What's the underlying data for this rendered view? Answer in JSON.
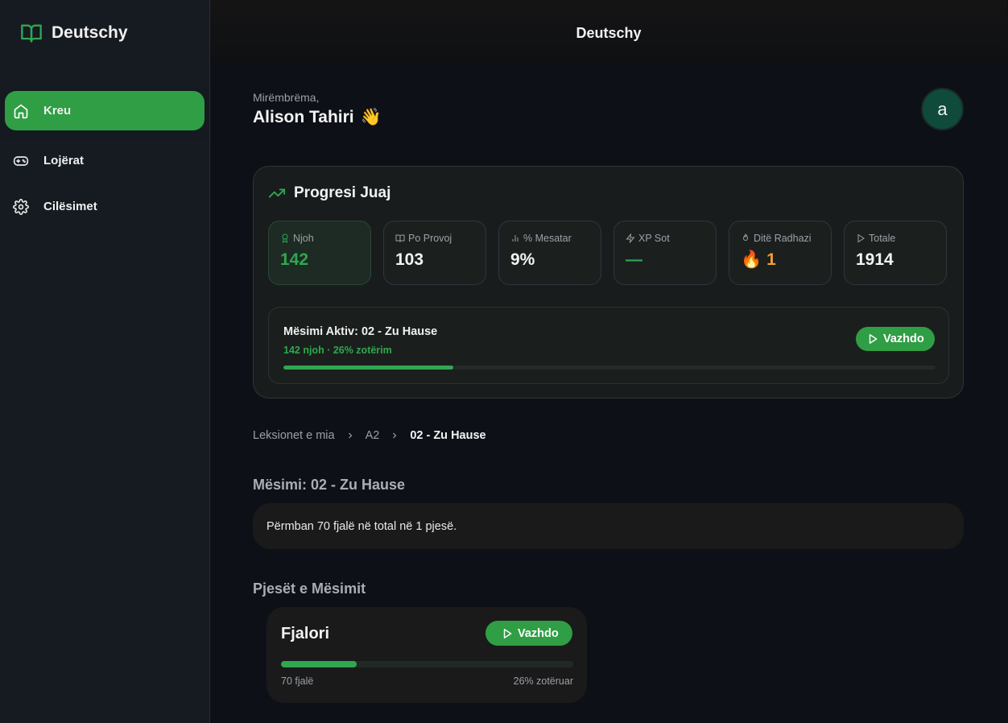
{
  "app": {
    "brand": "Deutschy",
    "topbar_title": "Deutschy"
  },
  "sidebar": {
    "items": [
      {
        "label": "Kreu",
        "icon": "home-icon",
        "active": true
      },
      {
        "label": "Lojërat",
        "icon": "gamepad-icon",
        "active": false
      },
      {
        "label": "Cilësimet",
        "icon": "gear-icon",
        "active": false
      }
    ]
  },
  "greeting": {
    "small": "Mirëmbrëma,",
    "name": "Alison Tahiri",
    "emoji": "👋"
  },
  "avatar": {
    "letter": "a"
  },
  "progress": {
    "title": "Progresi Juaj",
    "stats": [
      {
        "label": "Njoh",
        "icon": "award-icon",
        "value": "142"
      },
      {
        "label": "Po Provoj",
        "icon": "book-icon",
        "value": "103"
      },
      {
        "label": "% Mesatar",
        "icon": "bar-chart-icon",
        "value": "9%"
      },
      {
        "label": "XP Sot",
        "icon": "zap-icon",
        "value": "—"
      },
      {
        "label": "Ditë Radhazi",
        "icon": "flame-icon",
        "value": "1",
        "emoji": "🔥"
      },
      {
        "label": "Totale",
        "icon": "play-icon",
        "value": "1914"
      }
    ],
    "active_lesson": {
      "title": "Mësimi Aktiv: 02 - Zu Hause",
      "subtitle": "142 njoh · 26% zotërim",
      "progress_percent": 26,
      "button": "Vazhdo"
    }
  },
  "breadcrumb": {
    "items": [
      "Leksionet e mia",
      "A2",
      "02 - Zu Hause"
    ]
  },
  "lesson": {
    "title": "Mësimi: 02 - Zu Hause",
    "description": "Përmban 70 fjalë në total në 1 pjesë."
  },
  "parts": {
    "title": "Pjesët e Mësimit",
    "items": [
      {
        "title": "Fjalori",
        "button": "Vazhdo",
        "progress_percent": 26,
        "words": "70 fjalë",
        "mastery": "26% zotëruar"
      }
    ]
  },
  "colors": {
    "accent": "#2f9e44",
    "accent_text": "#2fa84f",
    "streak": "#f0a030",
    "background": "#0d1117"
  }
}
